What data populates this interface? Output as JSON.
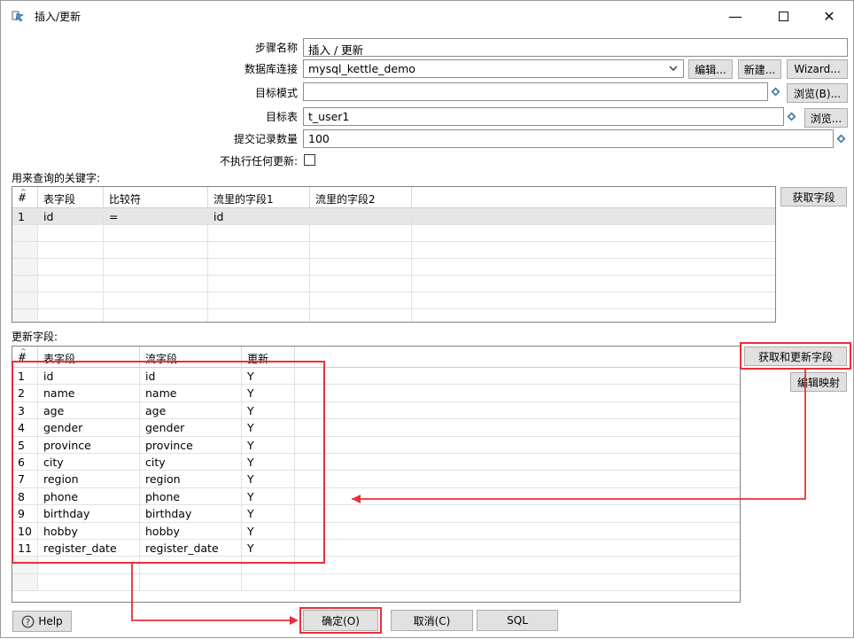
{
  "window": {
    "title": "插入/更新",
    "minimize": "—",
    "close": "✕"
  },
  "form": {
    "step_name_label": "步骤名称",
    "step_name_value": "插入 / 更新",
    "db_conn_label": "数据库连接",
    "db_conn_value": "mysql_kettle_demo",
    "edit_btn": "编辑...",
    "new_btn": "新建...",
    "wizard_btn": "Wizard...",
    "schema_label": "目标模式",
    "schema_value": "",
    "browse_b_btn": "浏览(B)...",
    "table_label": "目标表",
    "table_value": "t_user1",
    "browse_btn": "浏览...",
    "commit_label": "提交记录数量",
    "commit_value": "100",
    "no_update_label": "不执行任何更新:"
  },
  "key_section": {
    "title": "用来查询的关键字:",
    "get_fields_btn": "获取字段",
    "columns": [
      "#",
      "表字段",
      "比较符",
      "流里的字段1",
      "流里的字段2"
    ],
    "rows": [
      {
        "n": "1",
        "table_field": "id",
        "comparator": "=",
        "stream1": "id",
        "stream2": ""
      }
    ]
  },
  "update_section": {
    "title": "更新字段:",
    "get_update_btn": "获取和更新字段",
    "edit_mapping_btn": "编辑映射",
    "columns": [
      "#",
      "表字段",
      "流字段",
      "更新"
    ],
    "rows": [
      {
        "n": "1",
        "table_field": "id",
        "stream_field": "id",
        "update": "Y"
      },
      {
        "n": "2",
        "table_field": "name",
        "stream_field": "name",
        "update": "Y"
      },
      {
        "n": "3",
        "table_field": "age",
        "stream_field": "age",
        "update": "Y"
      },
      {
        "n": "4",
        "table_field": "gender",
        "stream_field": "gender",
        "update": "Y"
      },
      {
        "n": "5",
        "table_field": "province",
        "stream_field": "province",
        "update": "Y"
      },
      {
        "n": "6",
        "table_field": "city",
        "stream_field": "city",
        "update": "Y"
      },
      {
        "n": "7",
        "table_field": "region",
        "stream_field": "region",
        "update": "Y"
      },
      {
        "n": "8",
        "table_field": "phone",
        "stream_field": "phone",
        "update": "Y"
      },
      {
        "n": "9",
        "table_field": "birthday",
        "stream_field": "birthday",
        "update": "Y"
      },
      {
        "n": "10",
        "table_field": "hobby",
        "stream_field": "hobby",
        "update": "Y"
      },
      {
        "n": "11",
        "table_field": "register_date",
        "stream_field": "register_date",
        "update": "Y"
      }
    ]
  },
  "footer": {
    "help_btn": "Help",
    "ok_btn": "确定(O)",
    "cancel_btn": "取消(C)",
    "sql_btn": "SQL"
  },
  "colors": {
    "accent_red": "#e8303a",
    "selected_row": "#e6e6e6",
    "var_icon": "#4b7aa8"
  },
  "icons": [
    "app-icon",
    "variable-icon",
    "dropdown-arrow-icon",
    "help-icon",
    "sort-icon"
  ]
}
